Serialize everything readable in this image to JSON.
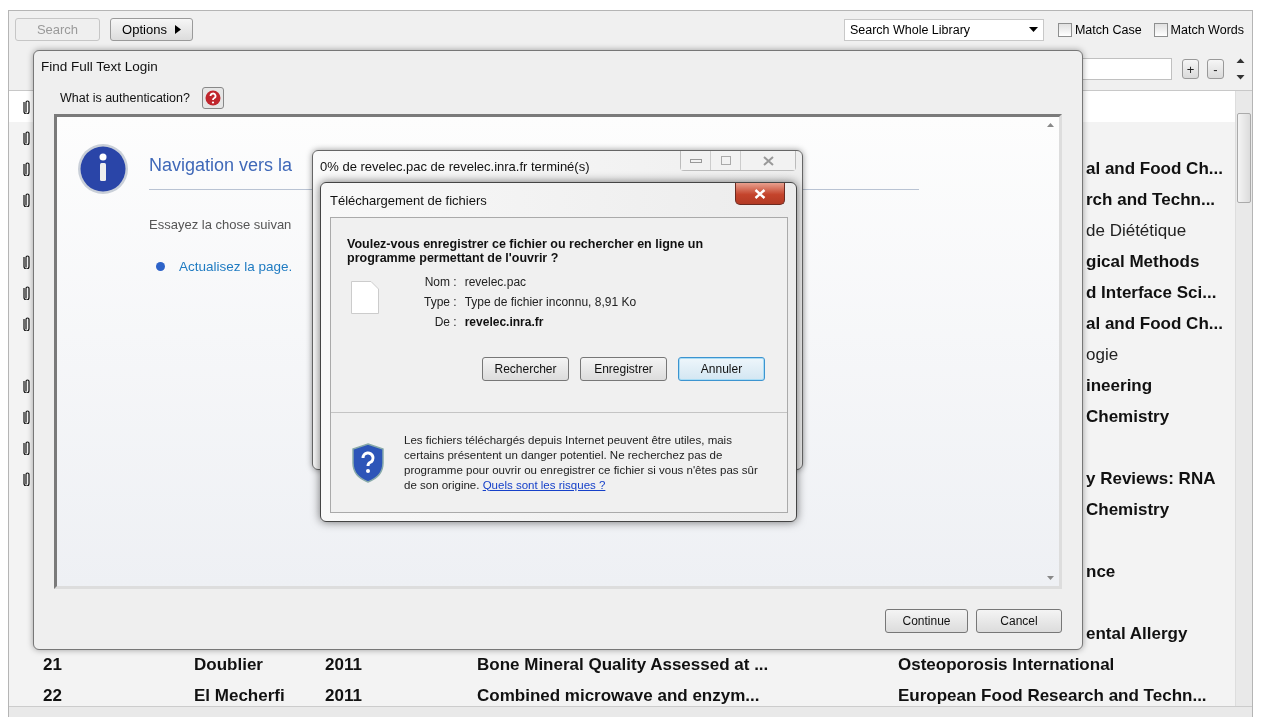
{
  "toolbar": {
    "search_button": {
      "label": "Search",
      "disabled": true
    },
    "options_button": {
      "label": "Options"
    },
    "scope_dropdown": {
      "value": "Search Whole Library"
    },
    "checkboxes": [
      {
        "label": "Match Case",
        "checked": false
      },
      {
        "label": "Match Words",
        "checked": false
      }
    ],
    "zoom_buttons": [
      "+",
      "-"
    ]
  },
  "table": {
    "rows": [
      {
        "attachment": true
      },
      {
        "attachment": true
      },
      {
        "attachment": true,
        "journal": "al and Food Ch...",
        "unread": true
      },
      {
        "attachment": true,
        "journal": "rch and Techn...",
        "unread": true
      },
      {
        "attachment": false,
        "journal": "de Diététique",
        "unread": false
      },
      {
        "attachment": true,
        "journal": "gical Methods",
        "unread": true
      },
      {
        "attachment": true,
        "journal": "d Interface Sci...",
        "unread": true
      },
      {
        "attachment": true,
        "journal": "al and Food Ch...",
        "unread": true
      },
      {
        "attachment": false,
        "journal": "ogie",
        "unread": false
      },
      {
        "attachment": true,
        "journal": "ineering",
        "unread": true
      },
      {
        "attachment": true,
        "journal": "Chemistry",
        "unread": true
      },
      {
        "attachment": true
      },
      {
        "attachment": true,
        "journal": "y Reviews: RNA",
        "unread": true
      },
      {
        "attachment": false,
        "journal": "Chemistry",
        "unread": true
      },
      {
        "attachment": false
      },
      {
        "attachment": false,
        "journal": "nce",
        "unread": true
      },
      {
        "attachment": false
      },
      {
        "attachment": false,
        "journal": "ental Allergy",
        "unread": true
      },
      {
        "attachment": false,
        "number": "21",
        "author": "Doublier",
        "year": "2011",
        "title": "Bone Mineral Quality Assessed at ...",
        "journal": "Osteoporosis International",
        "unread": true
      },
      {
        "attachment": false,
        "number": "22",
        "author": "El Mecherfi",
        "year": "2011",
        "title": "Combined microwave and enzym...",
        "journal": "European Food Research and Techn...",
        "unread": true
      }
    ]
  },
  "login_dialog": {
    "title": "Find Full Text Login",
    "help_label": "What is authentication?",
    "page": {
      "heading": "Navigation vers la",
      "prompt": "Essayez la chose suivan",
      "links": [
        "Actualisez la page."
      ]
    },
    "buttons": [
      "Continue",
      "Cancel"
    ]
  },
  "progress_dialog": {
    "title": "0% de revelec.pac de revelec.inra.fr terminé(s)"
  },
  "download_dialog": {
    "title": "Téléchargement de fichiers",
    "question": "Voulez-vous enregistrer ce fichier ou rechercher en ligne un programme permettant de l'ouvrir ?",
    "fields": [
      {
        "label": "Nom :",
        "value": "revelec.pac",
        "bold": false
      },
      {
        "label": "Type :",
        "value": "Type de fichier inconnu, 8,91 Ko",
        "bold": false
      },
      {
        "label": "De :",
        "value": "revelec.inra.fr",
        "bold": true
      }
    ],
    "buttons": [
      {
        "label": "Rechercher",
        "default": false
      },
      {
        "label": "Enregistrer",
        "default": false
      },
      {
        "label": "Annuler",
        "default": true
      }
    ],
    "warning": "Les fichiers téléchargés depuis Internet peuvent être utiles, mais certains présentent un danger potentiel. Ne recherchez pas de programme pour ouvrir ou enregistrer ce fichier si vous n'êtes pas sûr de son origine.",
    "warning_link": "Quels sont les risques ?"
  }
}
